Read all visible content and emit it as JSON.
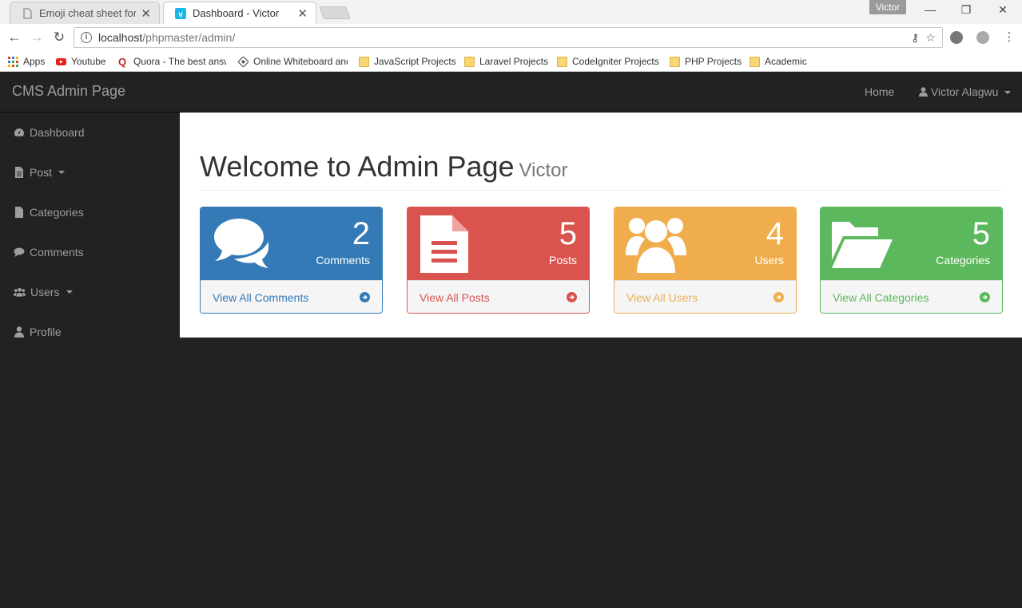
{
  "browser": {
    "tabs": [
      {
        "title": "Emoji cheat sheet for GitHub",
        "active": false
      },
      {
        "title": "Dashboard - Victor",
        "active": true
      }
    ],
    "profile_name": "Victor",
    "url_host": "localhost",
    "url_path": "/phpmaster/admin/",
    "bookmarks": [
      "Apps",
      "Youtube",
      "Quora - The best answer",
      "Online Whiteboard and",
      "JavaScript Projects",
      "Laravel Projects",
      "CodeIgniter Projects",
      "PHP Projects",
      "Academic"
    ]
  },
  "navbar": {
    "brand": "CMS Admin Page",
    "home_label": "Home",
    "user_label": "Victor Alagwu"
  },
  "sidebar": {
    "items": [
      {
        "label": "Dashboard",
        "icon": "dashboard-icon",
        "has_caret": false
      },
      {
        "label": "Post",
        "icon": "file-icon",
        "has_caret": true
      },
      {
        "label": "Categories",
        "icon": "file-icon",
        "has_caret": false
      },
      {
        "label": "Comments",
        "icon": "comment-icon",
        "has_caret": false
      },
      {
        "label": "Users",
        "icon": "users-icon",
        "has_caret": true
      },
      {
        "label": "Profile",
        "icon": "user-icon",
        "has_caret": false
      }
    ]
  },
  "page": {
    "title": "Welcome to Admin Page",
    "subtitle": "Victor"
  },
  "panels": [
    {
      "count": "2",
      "label": "Comments",
      "link": "View All Comments",
      "icon": "comments-icon",
      "color": "#337ab7"
    },
    {
      "count": "5",
      "label": "Posts",
      "link": "View All Posts",
      "icon": "file-text-icon",
      "color": "#d9534f"
    },
    {
      "count": "4",
      "label": "Users",
      "link": "View All Users",
      "icon": "users-icon",
      "color": "#f0ad4e"
    },
    {
      "count": "5",
      "label": "Categories",
      "link": "View All Categories",
      "icon": "folder-open-icon",
      "color": "#5cb85c"
    }
  ]
}
